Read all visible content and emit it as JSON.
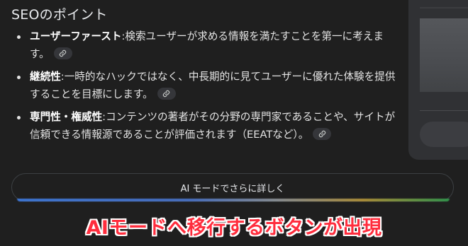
{
  "section": {
    "heading": "SEOのポイント"
  },
  "bullets": [
    {
      "term": "ユーザーファースト",
      "text": ":検索ユーザーが求める情報を満たすことを第一に考えます。",
      "icon": "link-icon"
    },
    {
      "term": "継続性",
      "text": ":一時的なハックではなく、中長期的に見てユーザーに優れた体験を提供することを目標にします。",
      "icon": "link-icon"
    },
    {
      "term": "専門性・権威性",
      "text": ":コンテンツの著者がその分野の専門家であることや、サイトが信頼できる情報源であることが評価されます（EEATなど）。",
      "icon": "link-icon"
    }
  ],
  "ai_mode_button": {
    "label": "AI モードでさらに詳しく"
  },
  "caption": {
    "text": "AIモードへ移行するボタンが出現",
    "color": "#ff2d3d"
  }
}
